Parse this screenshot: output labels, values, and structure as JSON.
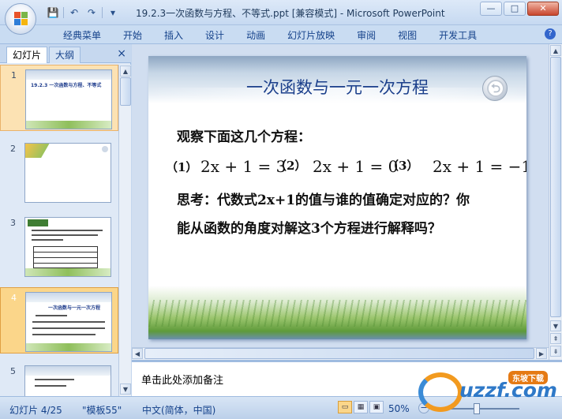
{
  "window": {
    "title": "19.2.3一次函数与方程、不等式.ppt [兼容模式] - Microsoft PowerPoint",
    "buttons": {
      "minimize": "—",
      "maximize": "□",
      "close": "✕"
    }
  },
  "quick_access": {
    "save": "💾",
    "undo": "↶",
    "redo": "↷",
    "customize": "▾"
  },
  "ribbon": {
    "tabs": [
      "经典菜单",
      "开始",
      "插入",
      "设计",
      "动画",
      "幻灯片放映",
      "审阅",
      "视图",
      "开发工具"
    ],
    "help": "?"
  },
  "left_pane": {
    "tabs": [
      "幻灯片",
      "大纲"
    ],
    "close": "×",
    "thumbnails": [
      {
        "number": "1",
        "title": "19.2.3 一次函数与方程、不等式"
      },
      {
        "number": "2",
        "title": ""
      },
      {
        "number": "3",
        "title": ""
      },
      {
        "number": "4",
        "title": "一次函数与一元一次方程"
      },
      {
        "number": "5",
        "title": ""
      }
    ]
  },
  "slide": {
    "title": "一次函数与一元一次方程",
    "line1": "观察下面这几个方程：",
    "eq1_label": "（1）",
    "eq1": "2x + 1 = 3",
    "eq2_label": "（2）",
    "eq2": "2x + 1 = 0",
    "eq3_label": "（3）",
    "eq3": "2x + 1 = −1",
    "think1": "思考：代数式2x+1的值与谁的值确定对应的？你",
    "think2": "能从函数的角度对解这3个方程进行解释吗？",
    "back_icon": "⮌"
  },
  "notes": {
    "placeholder": "单击此处添加备注"
  },
  "status": {
    "slide_pos": "幻灯片 4/25",
    "template": "\"模板55\"",
    "language": "中文(简体，中国)",
    "zoom": "50%",
    "zoom_minus": "−"
  },
  "watermark": {
    "text": "uzzf.com",
    "tag": "东坡下载"
  },
  "colors": {
    "slide_title": "#1b3f8b",
    "selected_thumb": "#fbd68a",
    "ribbon_text": "#15428b"
  }
}
